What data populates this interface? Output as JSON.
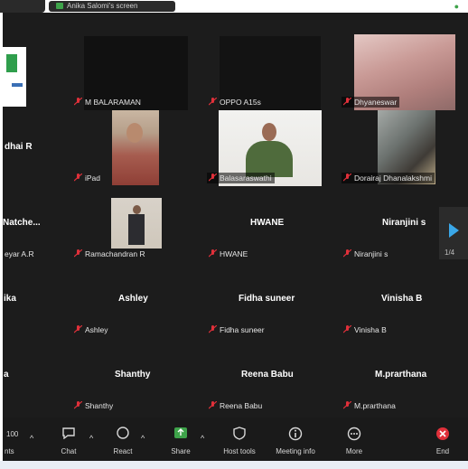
{
  "window": {
    "share_title": "Anika Salomi's screen"
  },
  "tiles": {
    "logo_partial": "",
    "balaraman": "M BALARAMAN",
    "oppo": "OPPO A15s",
    "dhyaneswar": "Dhyaneswar",
    "dhai_big": "dhai R",
    "ipad": "iPad",
    "balasaraswathi": "Balasaraswathi",
    "dorairaj": "Dorairaj Dhanalakshmi",
    "natche_big": "Natche...",
    "eyar": "eyar A.R",
    "ramachandran": "Ramachandran R",
    "hwane_big": "HWANE",
    "hwane": "HWANE",
    "niranjini_big": "Niranjini s",
    "niranjini": "Niranjini s",
    "ika_big": "ika",
    "ashley_big": "Ashley",
    "ashley": "Ashley",
    "fidha_big": "Fidha suneer",
    "fidha": "Fidha suneer",
    "vinisha_big": "Vinisha B",
    "vinisha": "Vinisha B",
    "a_big": "a",
    "shanthy_big": "Shanthy",
    "shanthy": "Shanthy",
    "reena_big": "Reena Babu",
    "reena": "Reena Babu",
    "prarthana_big": "M.prarthana",
    "prarthana": "M.prarthana"
  },
  "pager": {
    "page": "1/4"
  },
  "toolbar": {
    "participants_count": "100",
    "participants_label": "nts",
    "chat": "Chat",
    "react": "React",
    "share": "Share",
    "host_tools": "Host tools",
    "meeting_info": "Meeting info",
    "more": "More",
    "end": "End"
  },
  "colors": {
    "accent_green": "#3ea34a",
    "end_red": "#e0303a",
    "nav_blue": "#3aa7e8",
    "mic_muted_red": "#e0303a"
  }
}
